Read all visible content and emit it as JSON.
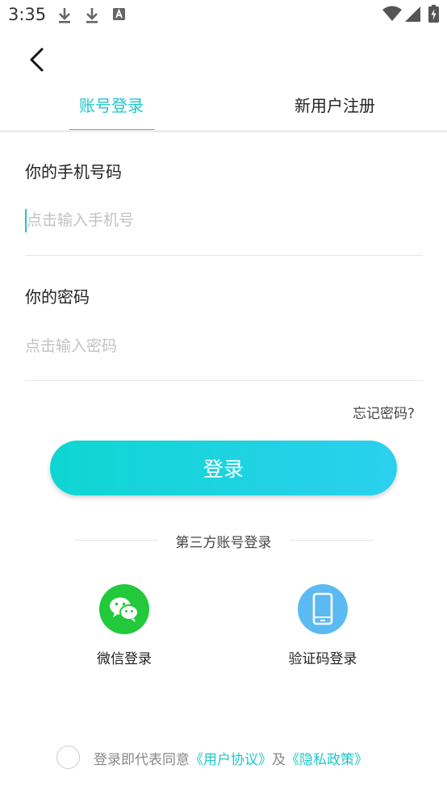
{
  "status_bar": {
    "time": "3:35",
    "icons": [
      "download-icon",
      "download-icon",
      "text-a-icon",
      "wifi-icon",
      "cell-signal-icon",
      "battery-charging-icon"
    ]
  },
  "nav": {
    "back_icon": "chevron-left-icon"
  },
  "tabs": [
    {
      "label": "账号登录",
      "active": true
    },
    {
      "label": "新用户注册",
      "active": false
    }
  ],
  "phone": {
    "label": "你的手机号码",
    "placeholder": "点击输入手机号",
    "value": ""
  },
  "password": {
    "label": "你的密码",
    "placeholder": "点击输入密码",
    "value": ""
  },
  "forgot_label": "忘记密码?",
  "login_button_label": "登录",
  "third_party": {
    "title": "第三方账号登录",
    "options": [
      {
        "label": "微信登录",
        "icon": "wechat-icon",
        "color": "#22c93a"
      },
      {
        "label": "验证码登录",
        "icon": "phone-icon",
        "color": "#5bbaf2"
      }
    ]
  },
  "agreement": {
    "prefix": "登录即代表同意",
    "user_agreement": "《用户协议》",
    "and": "及",
    "privacy_policy": "《隐私政策》",
    "checked": false
  },
  "colors": {
    "accent": "#1fc6cc",
    "button_start": "#0ed6d2",
    "button_end": "#2bd0ee"
  }
}
